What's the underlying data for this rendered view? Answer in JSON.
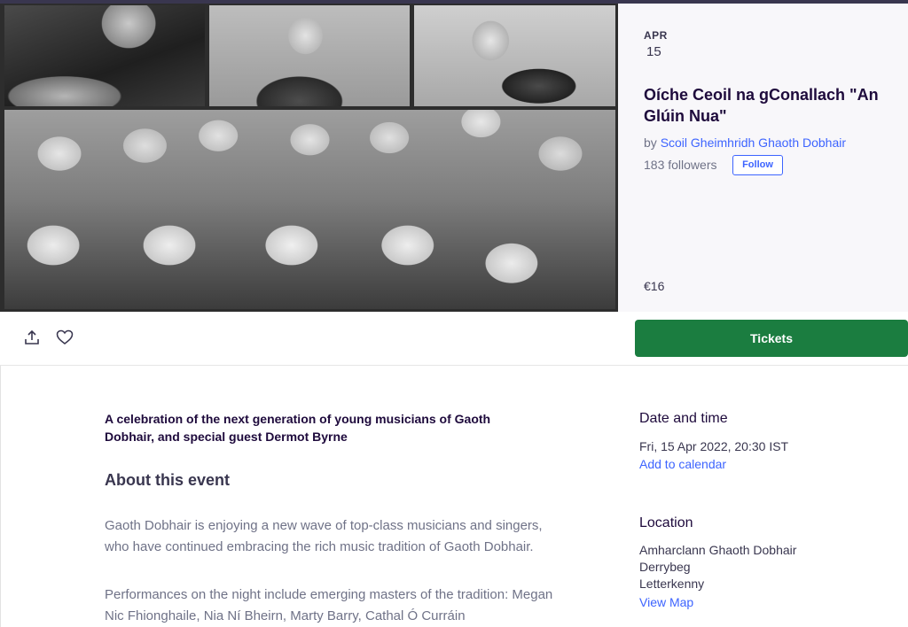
{
  "event": {
    "month": "APR",
    "day": "15",
    "title": "Oíche Ceoil na gConallach \"An Glúin Nua\"",
    "organizer_prefix": "by ",
    "organizer_name": "Scoil Gheimhridh Ghaoth Dobhair",
    "followers": "183 followers",
    "follow_label": "Follow",
    "price": "€16"
  },
  "actions": {
    "share_icon": "share-icon",
    "like_icon": "heart-icon",
    "tickets_label": "Tickets"
  },
  "content": {
    "summary": "A celebration of the next generation of young musicians of Gaoth Dobhair, and special guest Dermot Byrne",
    "about_heading": "About this event",
    "paragraph_1": "Gaoth Dobhair is enjoying a new wave of top-class musicians and singers, who have continued embracing the rich music tradition of Gaoth Dobhair.",
    "paragraph_2": "Performances on the night include emerging masters of the tradition: Megan Nic Fhionghaile, Nia Ní Bheirn, Marty Barry, Cathal Ó Curráin"
  },
  "sidebar": {
    "date_heading": "Date and time",
    "date_value": "Fri, 15 Apr 2022, 20:30 IST",
    "add_calendar": "Add to calendar",
    "location_heading": "Location",
    "location_lines": [
      "Amharclann Ghaoth Dobhair",
      "Derrybeg",
      "Letterkenny"
    ],
    "view_map": "View Map"
  },
  "colors": {
    "accent_blue": "#3d64ff",
    "tickets_green": "#1b7d40",
    "title_dark": "#1e0a3c",
    "muted_text": "#6f7287"
  }
}
